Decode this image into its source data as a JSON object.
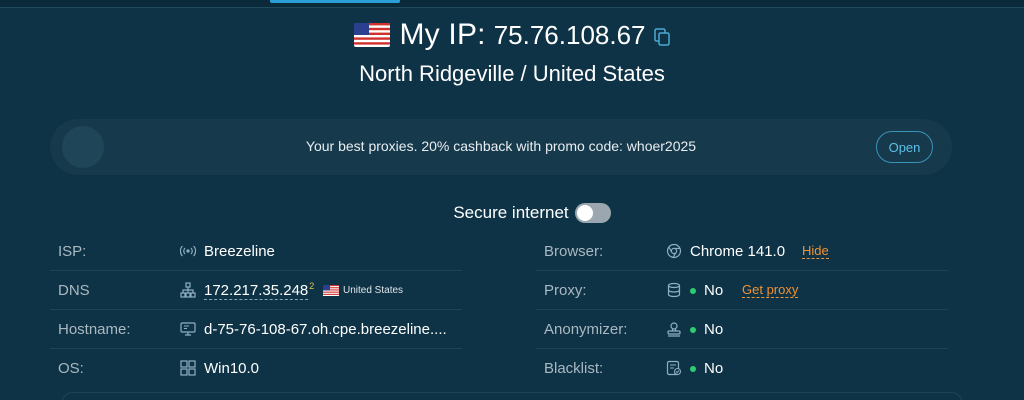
{
  "header": {
    "ip_label": "My IP:",
    "ip_value": "75.76.108.67",
    "location": "North Ridgeville / United States"
  },
  "promo": {
    "text": "Your best proxies. 20% cashback with promo code: whoer2025",
    "button": "Open"
  },
  "secure": {
    "label": "Secure internet",
    "enabled": false
  },
  "left_rows": {
    "isp": {
      "label": "ISP:",
      "value": "Breezeline",
      "icon": "broadcast-icon"
    },
    "dns": {
      "label": "DNS",
      "value": "172.217.35.248",
      "superscript": "2",
      "country": "United States",
      "icon": "network-icon"
    },
    "hostname": {
      "label": "Hostname:",
      "value": "d-75-76-108-67.oh.cpe.breezeline....",
      "icon": "monitor-icon"
    },
    "os": {
      "label": "OS:",
      "value": "Win10.0",
      "icon": "windows-icon"
    }
  },
  "right_rows": {
    "browser": {
      "label": "Browser:",
      "value": "Chrome 141.0",
      "action": "Hide",
      "icon": "chrome-icon"
    },
    "proxy": {
      "label": "Proxy:",
      "value": "No",
      "action": "Get proxy",
      "icon": "database-icon"
    },
    "anonymizer": {
      "label": "Anonymizer:",
      "value": "No",
      "icon": "user-stamp-icon"
    },
    "blacklist": {
      "label": "Blacklist:",
      "value": "No",
      "icon": "list-check-icon"
    }
  },
  "colors": {
    "background": "#0e3346",
    "accent": "#2a9fd6",
    "action": "#f09232",
    "status_ok": "#2ecc71"
  }
}
